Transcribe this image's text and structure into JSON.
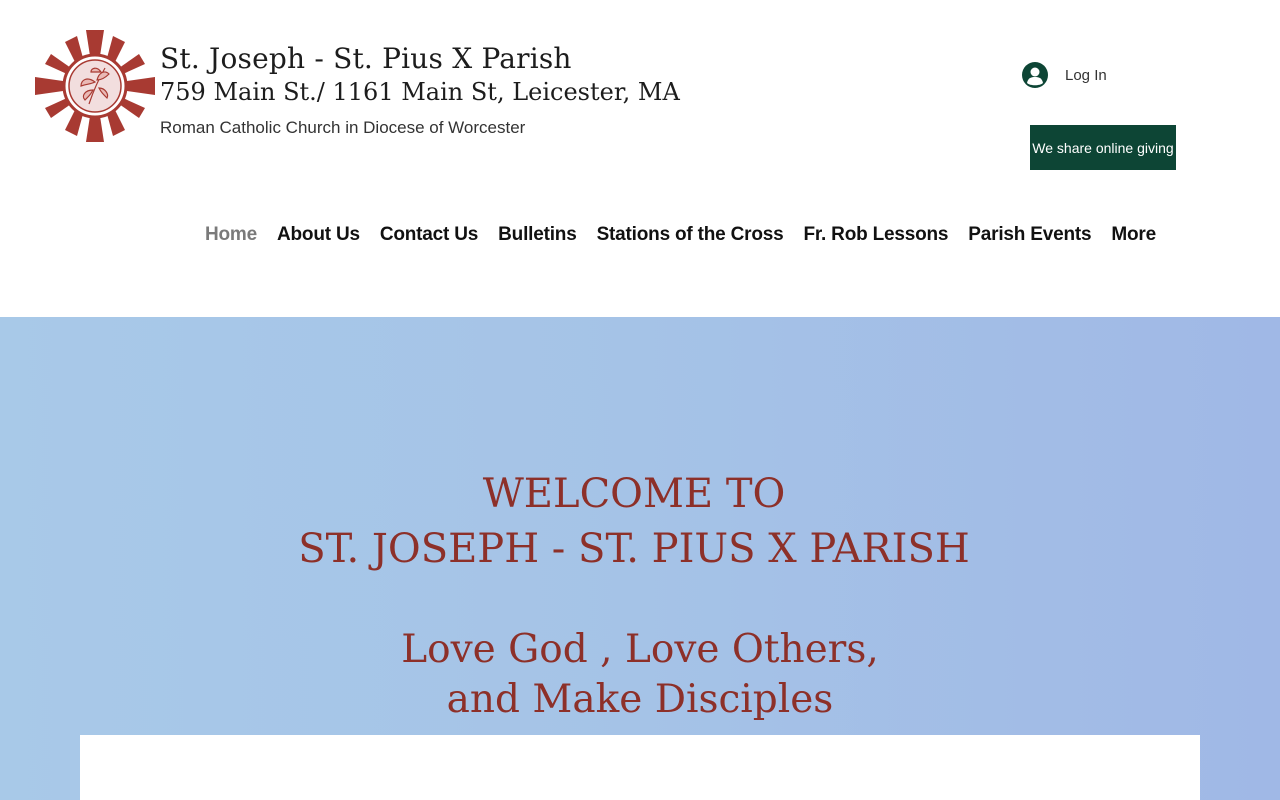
{
  "header": {
    "title": "St. Joseph - St. Pius X Parish",
    "address": "759 Main St./ 1161 Main St, Leicester, MA",
    "subtitle": "Roman Catholic Church in Diocese of Worcester",
    "login_label": "Log In",
    "giving_label": "We share online giving"
  },
  "nav": {
    "items": [
      {
        "label": "Home",
        "active": true
      },
      {
        "label": "About Us"
      },
      {
        "label": "Contact Us"
      },
      {
        "label": "Bulletins"
      },
      {
        "label": "Stations of the Cross"
      },
      {
        "label": "Fr. Rob Lessons"
      },
      {
        "label": "Parish Events"
      },
      {
        "label": "More"
      }
    ]
  },
  "hero": {
    "welcome_line1": "WELCOME TO",
    "welcome_line2": "ST. JOSEPH - ST. PIUS X PARISH",
    "motto_line1": "Love God , Love Others,",
    "motto_line2": "and Make Disciples"
  },
  "colors": {
    "accent": "#8d3029",
    "button_bg": "#0d4535",
    "logo_red": "#a83a32"
  },
  "icons": {
    "logo": "parish-logo-icon",
    "login": "user-avatar-icon"
  }
}
